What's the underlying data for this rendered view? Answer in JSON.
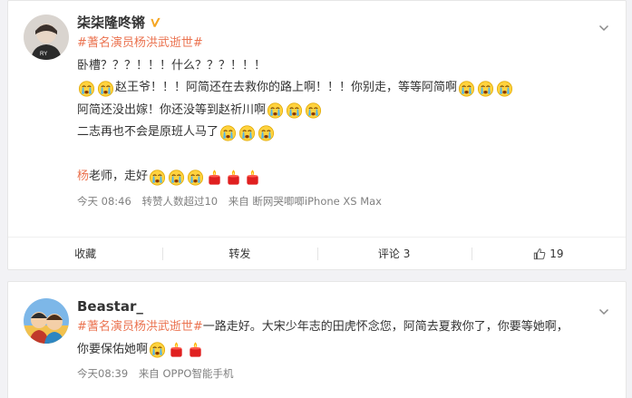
{
  "posts": [
    {
      "user": {
        "name": "柒柒隆咚锵"
      },
      "topic": "#蓍名演员杨洪武逝世#",
      "lines": {
        "l1": "卧槽？？？！！！什么？？？！！！",
        "l2a": "赵王爷！！！阿简还在去救你的路上啊！！！你别走，等等阿简啊",
        "l3a": "阿简还没出嫁！你还没等到赵祈川啊",
        "l4a": "二志再也不会是原班人马了",
        "l5_name": "杨",
        "l5_rest": "老师，走好"
      },
      "meta": {
        "time": "今天 08:46",
        "reposts": "转赞人数超过10",
        "source": "来自 断网哭唧唧iPhone XS Max"
      },
      "actions": {
        "favorite": "收藏",
        "repost": "转发",
        "comment": "评论 3",
        "like_count": "19"
      }
    },
    {
      "user": {
        "name": "Beastar_"
      },
      "topic": "#蓍名演员杨洪武逝世#",
      "lines": {
        "l1a": "一路走好。大宋少年志的田虎怀念您，阿简去夏救你了，你要等她啊，",
        "l2a": "你要保佑她啊"
      },
      "meta": {
        "time": "今天08:39",
        "source": "来自 OPPO智能手机"
      }
    }
  ],
  "icons": {
    "crying": "crying-face-emoji",
    "candle": "candle-emoji",
    "verified": "verified-badge-icon",
    "chevron": "chevron-down-icon",
    "thumb": "thumbs-up-icon"
  },
  "colors": {
    "link": "#eb7350",
    "verified": "#f5a623"
  }
}
